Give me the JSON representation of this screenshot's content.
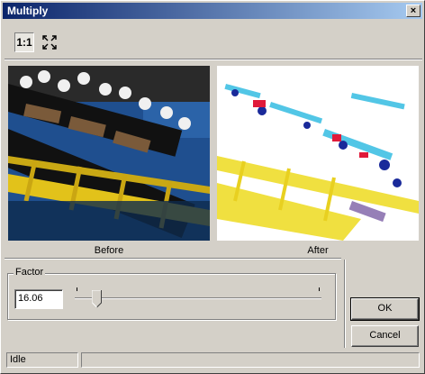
{
  "window": {
    "title": "Multiply",
    "close_label": "×"
  },
  "toolbar": {
    "zoom_1to1_label": "1:1",
    "fit_icon": "fit-to-window-icon"
  },
  "preview": {
    "before_label": "Before",
    "after_label": "After"
  },
  "factor": {
    "group_label": "Factor",
    "value": "16.06",
    "slider_position": 0.08
  },
  "buttons": {
    "ok_label": "OK",
    "cancel_label": "Cancel"
  },
  "statusbar": {
    "status_text": "Idle",
    "secondary_text": ""
  },
  "colors": {
    "title_start": "#0a246a",
    "title_end": "#a6caf0",
    "face": "#d4d0c8"
  }
}
